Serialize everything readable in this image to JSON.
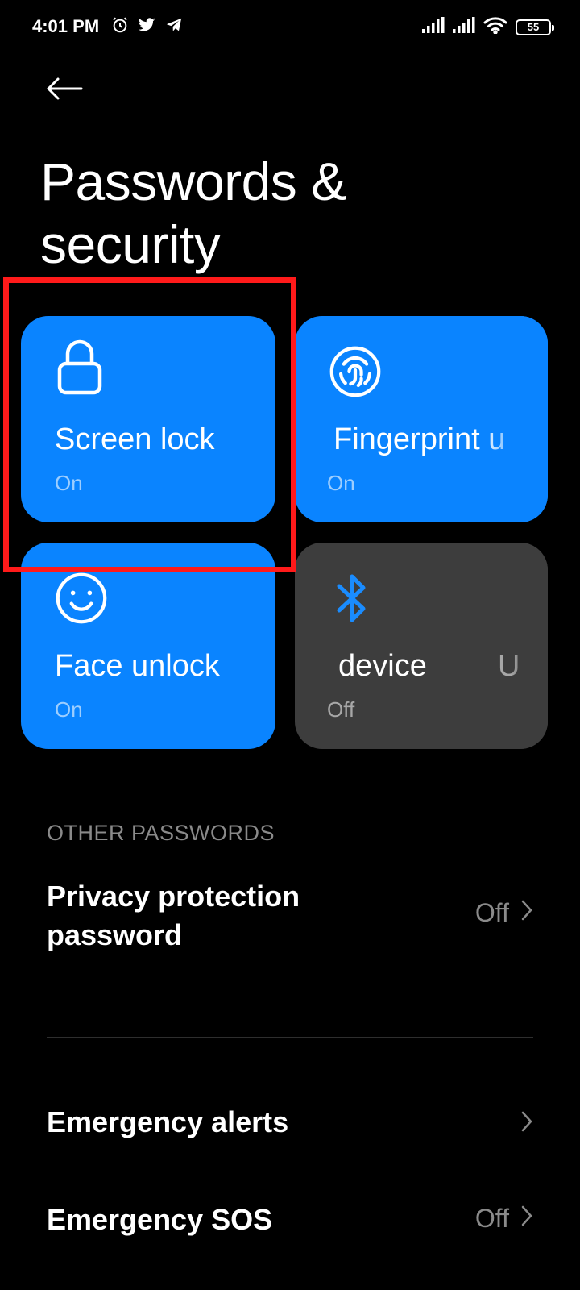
{
  "status_bar": {
    "time": "4:01 PM",
    "battery_level": "55",
    "icons": [
      "alarm-icon",
      "twitter-icon",
      "telegram-icon",
      "signal-icon",
      "signal-icon",
      "wifi-icon",
      "battery-icon"
    ]
  },
  "header": {
    "back_icon": "arrow-left-icon",
    "title": "Passwords & security"
  },
  "tiles": [
    {
      "label": "Screen lock",
      "status": "On",
      "icon": "lock-icon",
      "color": "#0a84ff"
    },
    {
      "label": "Fingerprint u",
      "status": "On",
      "icon": "fingerprint-icon",
      "color": "#0a84ff"
    },
    {
      "label": "Face unlock",
      "status": "On",
      "icon": "face-icon",
      "color": "#0a84ff"
    },
    {
      "label": "device",
      "label_trailing": "U",
      "status": "Off",
      "icon": "bluetooth-icon",
      "color": "#3d3d3d"
    }
  ],
  "highlight_color": "#ff1a1a",
  "sections": {
    "other_passwords": "OTHER PASSWORDS"
  },
  "list": [
    {
      "title_line1": "Privacy protection",
      "title_line2": "password",
      "value": "Off"
    },
    {
      "title": "Emergency alerts"
    },
    {
      "title": "Emergency SOS",
      "value": "Off"
    }
  ]
}
